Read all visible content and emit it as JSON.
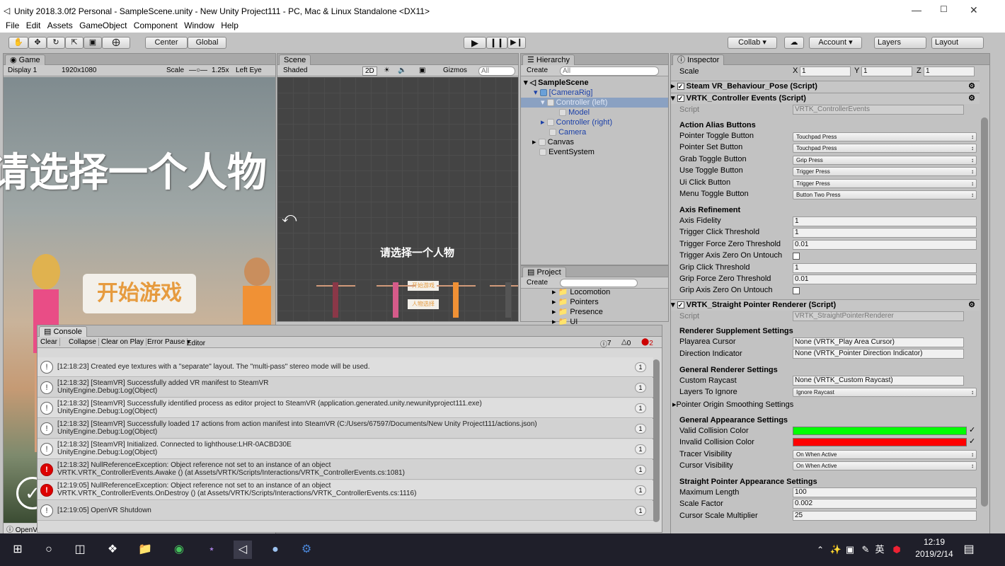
{
  "window": {
    "title": "Unity 2018.3.0f2 Personal - SampleScene.unity - New Unity Project111 - PC, Mac & Linux Standalone <DX11>",
    "min": "—",
    "max": "☐",
    "close": "✕"
  },
  "menu": [
    "File",
    "Edit",
    "Assets",
    "GameObject",
    "Component",
    "Window",
    "Help"
  ],
  "toolbar": {
    "center": "Center",
    "global": "Global",
    "collab": "Collab",
    "account": "Account",
    "layers": "Layers",
    "layout": "Layout"
  },
  "game": {
    "tab": "Game",
    "display": "Display 1",
    "resolution": "1920x1080",
    "scale_label": "Scale",
    "scale": "1.25x",
    "eye": "Left Eye",
    "heading": "请选择一个人物",
    "start": "开始游戏",
    "status": "OpenV"
  },
  "scene": {
    "tab": "Scene",
    "shading": "Shaded",
    "mode2d": "2D",
    "gizmos": "Gizmos",
    "search": "All",
    "heading": "请选择一个人物",
    "btn1": "开始游戏",
    "btn2": "人物选择"
  },
  "hierarchy": {
    "tab": "Hierarchy",
    "create": "Create",
    "search": "All",
    "items": [
      "SampleScene",
      "[CameraRig]",
      "Controller (left)",
      "Model",
      "Controller (right)",
      "Camera",
      "Canvas",
      "EventSystem"
    ]
  },
  "project": {
    "tab": "Project",
    "create": "Create",
    "items": [
      "Locomotion",
      "Pointers",
      "Presence",
      "UI"
    ]
  },
  "console": {
    "tab": "Console",
    "buttons": [
      "Clear",
      "Collapse",
      "Clear on Play",
      "Error Pause",
      "Editor"
    ],
    "counts": {
      "log": "7",
      "warn": "0",
      "err": "2"
    },
    "rows": [
      {
        "type": "log",
        "l1": "[12:18:23] Created eye textures with a \"separate\" layout.  The \"multi-pass\" stereo mode will be used.",
        "l2": "",
        "count": "1"
      },
      {
        "type": "log",
        "l1": "[12:18:32] [SteamVR] Successfully added VR manifest to SteamVR",
        "l2": "UnityEngine.Debug:Log(Object)",
        "count": "1"
      },
      {
        "type": "log",
        "l1": "[12:18:32] [SteamVR] Successfully identified process as editor project to SteamVR (application.generated.unity.newunityproject111.exe)",
        "l2": "UnityEngine.Debug:Log(Object)",
        "count": "1"
      },
      {
        "type": "log",
        "l1": "[12:18:32] [SteamVR] Successfully loaded 17 actions from action manifest into SteamVR (C:/Users/67597/Documents/New Unity Project111/actions.json)",
        "l2": "UnityEngine.Debug:Log(Object)",
        "count": "1"
      },
      {
        "type": "log",
        "l1": "[12:18:32] [SteamVR] Initialized. Connected to lighthouse:LHR-0ACBD30E",
        "l2": "UnityEngine.Debug:Log(Object)",
        "count": "1"
      },
      {
        "type": "err",
        "l1": "[12:18:32] NullReferenceException: Object reference not set to an instance of an object",
        "l2": "VRTK.VRTK_ControllerEvents.Awake () (at Assets/VRTK/Scripts/Interactions/VRTK_ControllerEvents.cs:1081)",
        "count": "1"
      },
      {
        "type": "err",
        "l1": "[12:19:05] NullReferenceException: Object reference not set to an instance of an object",
        "l2": "VRTK.VRTK_ControllerEvents.OnDestroy () (at Assets/VRTK/Scripts/Interactions/VRTK_ControllerEvents.cs:1116)",
        "count": "1"
      },
      {
        "type": "log",
        "l1": "[12:19:05] OpenVR Shutdown",
        "l2": "",
        "count": "1"
      }
    ]
  },
  "inspector": {
    "tab": "Inspector",
    "scale_label": "Scale",
    "sx": "1",
    "sy": "1",
    "sz": "1",
    "comp1": "Steam VR_Behaviour_Pose (Script)",
    "comp2": "VRTK_Controller Events (Script)",
    "script_label": "Script",
    "script2": "VRTK_ControllerEvents",
    "h_alias": "Action Alias Buttons",
    "alias": [
      [
        "Pointer Toggle Button",
        "Touchpad Press"
      ],
      [
        "Pointer Set Button",
        "Touchpad Press"
      ],
      [
        "Grab Toggle Button",
        "Grip Press"
      ],
      [
        "Use Toggle Button",
        "Trigger Press"
      ],
      [
        "Ui Click Button",
        "Trigger Press"
      ],
      [
        "Menu Toggle Button",
        "Button Two Press"
      ]
    ],
    "h_axis": "Axis Refinement",
    "axis": [
      [
        "Axis Fidelity",
        "1"
      ],
      [
        "Trigger Click Threshold",
        "1"
      ],
      [
        "Trigger Force Zero Threshold",
        "0.01"
      ],
      [
        "Trigger Axis Zero On Untouch",
        ""
      ],
      [
        "Grip Click Threshold",
        "1"
      ],
      [
        "Grip Force Zero Threshold",
        "0.01"
      ],
      [
        "Grip Axis Zero On Untouch",
        ""
      ]
    ],
    "comp3": "VRTK_Straight Pointer Renderer (Script)",
    "script3": "VRTK_StraightPointerRenderer",
    "h_supp": "Renderer Supplement Settings",
    "supp": [
      [
        "Playarea Cursor",
        "None (VRTK_Play Area Cursor)"
      ],
      [
        "Direction Indicator",
        "None (VRTK_Pointer Direction Indicator)"
      ]
    ],
    "h_gen": "General Renderer Settings",
    "custom_raycast_label": "Custom Raycast",
    "custom_raycast": "None (VRTK_Custom Raycast)",
    "layers_label": "Layers To Ignore",
    "layers": "Ignore Raycast",
    "origin_smoothing": "Pointer Origin Smoothing Settings",
    "h_app": "General Appearance Settings",
    "valid_label": "Valid Collision Color",
    "valid_color": "#00ff00",
    "invalid_label": "Invalid Collision Color",
    "invalid_color": "#ff0000",
    "tracer_label": "Tracer Visibility",
    "tracer": "On When Active",
    "cursor_label": "Cursor Visibility",
    "cursor": "On When Active",
    "h_straight": "Straight Pointer Appearance Settings",
    "straight": [
      [
        "Maximum Length",
        "100"
      ],
      [
        "Scale Factor",
        "0.002"
      ],
      [
        "Cursor Scale Multiplier",
        "25"
      ]
    ]
  },
  "taskbar": {
    "ime": "英",
    "time": "12:19",
    "date": "2019/2/14"
  }
}
